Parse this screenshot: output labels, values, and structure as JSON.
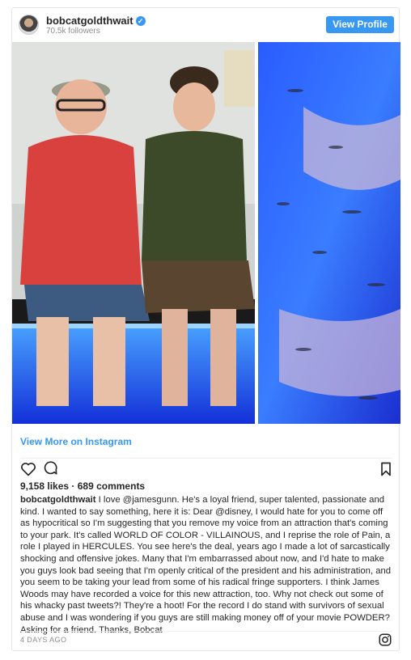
{
  "header": {
    "username": "bobcatgoldthwait",
    "followers": "70.5k followers",
    "view_profile_label": "View Profile"
  },
  "post": {
    "view_more_label": "View More on Instagram",
    "likes": "9,158 likes",
    "comments": "689 comments",
    "caption_user": "bobcatgoldthwait",
    "caption_text": "I love @jamesgunn. He's a loyal friend, super talented, passionate and kind. I wanted to say something, here it is: Dear @disney, I would hate for you to come off as hypocritical so I'm suggesting that you remove my voice from an attraction that's coming to your park. It's called WORLD OF COLOR - VILLAINOUS, and I reprise the role of Pain, a role I played in HERCULES. You see here's the deal, years ago I made a lot of sarcastically shocking and offensive jokes. Many that I'm embarrassed about now, and I'd hate to make you guys look bad seeing that I'm openly critical of the president and his administration, and you seem to be taking your lead from some of his radical fringe supporters. I think James Woods may have recorded a voice for this new attraction, too. Why not check out some of his whacky past tweets?! They're a hoot! For the record I do stand with survivors of sexual abuse and I was wondering if you guys are still making money off of your movie POWDER? Asking for a friend. Thanks, Bobcat",
    "timestamp": "4 DAYS AGO"
  },
  "icons": {
    "avatar": "profile-avatar",
    "verified": "verified-badge-icon",
    "like": "heart-icon",
    "comment": "comment-bubble-icon",
    "save": "bookmark-icon",
    "instagram": "instagram-logo-icon"
  },
  "colors": {
    "accent": "#3897f0",
    "text": "#262626",
    "muted": "#8e8e8e"
  }
}
